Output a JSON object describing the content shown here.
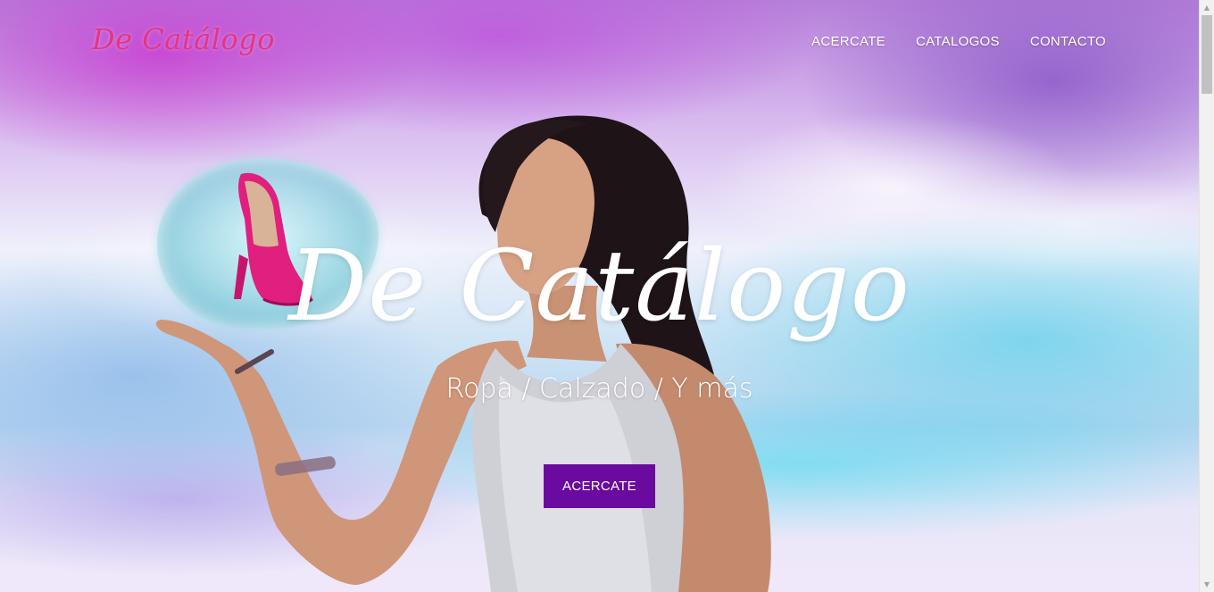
{
  "nav": {
    "brand": "De Catálogo",
    "links": [
      "ACERCATE",
      "CATALOGOS",
      "CONTACTO"
    ]
  },
  "hero": {
    "title": "De Catálogo",
    "subtitle": "Ropa / Calzado / Y más",
    "cta_label": "ACERCATE"
  },
  "scrollbar": {
    "up_icon": "triangle-up",
    "down_icon": "triangle-down"
  },
  "colors": {
    "brand": "#e6357f",
    "cta": "#6a0a9e",
    "nav_text": "#ffffff"
  }
}
